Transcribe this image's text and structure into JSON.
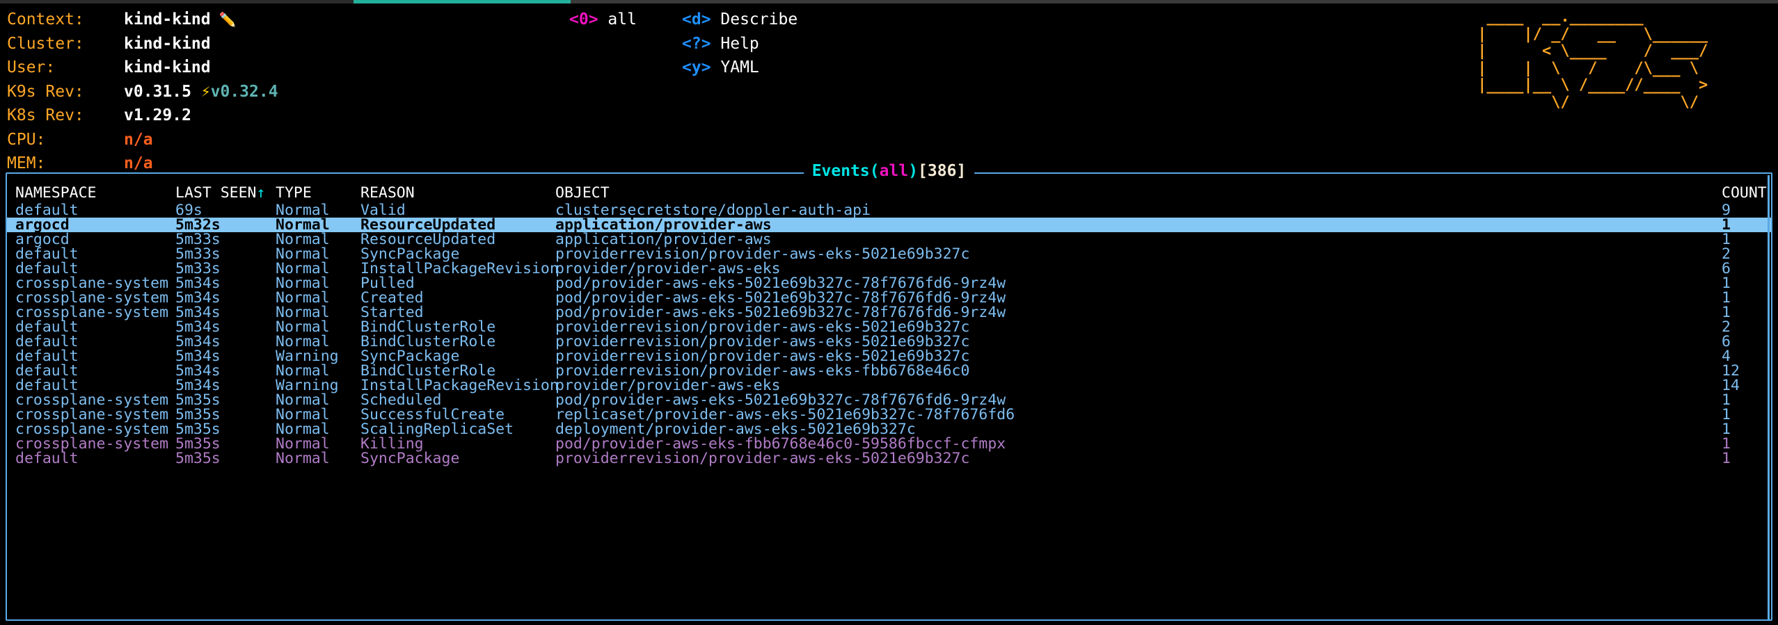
{
  "app": {
    "name": "k9s",
    "logo_art": [
      " ____  __.________              ",
      "|    |/ _/   __   \\______      ",
      "|      < \\____    /  ___/      ",
      "|    |  \\   /    /\\___ \\     ",
      "|____|__ \\ /____//____  >      ",
      "        \\/            \\/       "
    ]
  },
  "colors": {
    "accent_orange": "#ffa726",
    "accent_cyan": "#00e5e5",
    "accent_magenta": "#f012be",
    "accent_blue": "#1e90ff",
    "row_text": "#7dbdf0",
    "row_killing": "#b07cc6",
    "selected_bg": "#85c8f5",
    "border_blue": "#5aa9e6",
    "na_orange": "#ff5f1f",
    "new_version_teal": "#5fb3b3",
    "strip_teal": "#23b09b"
  },
  "cluster_info": {
    "rows": [
      {
        "key": "Context:",
        "value": "kind-kind",
        "icon": "pencil-icon",
        "icon_glyph": "✏️"
      },
      {
        "key": "Cluster:",
        "value": "kind-kind"
      },
      {
        "key": "User:",
        "value": "kind-kind"
      },
      {
        "key": "K9s Rev:",
        "value": "v0.31.5",
        "new_version": "v0.32.4",
        "bolt_glyph": "⚡"
      },
      {
        "key": "K8s Rev:",
        "value": "v1.29.2"
      },
      {
        "key": "CPU:",
        "value": "n/a",
        "na": true
      },
      {
        "key": "MEM:",
        "value": "n/a",
        "na": true
      }
    ]
  },
  "hints": {
    "left": [
      {
        "key": "<0>",
        "label": "all",
        "key_color": "magenta"
      }
    ],
    "right": [
      {
        "key": "<d>",
        "label": "Describe",
        "key_color": "blue"
      },
      {
        "key": "<?>",
        "label": "Help",
        "key_color": "blue"
      },
      {
        "key": "<y>",
        "label": "YAML",
        "key_color": "blue"
      }
    ]
  },
  "panel": {
    "title_main": "Events",
    "title_open_paren": "(",
    "title_scope": "all",
    "title_close_paren": ")",
    "title_count": "[386]"
  },
  "table": {
    "columns": [
      {
        "key": "namespace",
        "label": "NAMESPACE"
      },
      {
        "key": "last_seen",
        "label": "LAST SEEN",
        "sorted": true,
        "sort_glyph": "↑"
      },
      {
        "key": "type",
        "label": "TYPE"
      },
      {
        "key": "reason",
        "label": "REASON"
      },
      {
        "key": "object",
        "label": "OBJECT"
      },
      {
        "key": "count",
        "label": "COUNT"
      }
    ],
    "rows": [
      {
        "namespace": "default",
        "last_seen": "69s",
        "type": "Normal",
        "reason": "Valid",
        "object": "clustersecretstore/doppler-auth-api",
        "count": "9",
        "state": "normal"
      },
      {
        "namespace": "argocd",
        "last_seen": "5m32s",
        "type": "Normal",
        "reason": "ResourceUpdated",
        "object": "application/provider-aws",
        "count": "1",
        "state": "selected"
      },
      {
        "namespace": "argocd",
        "last_seen": "5m33s",
        "type": "Normal",
        "reason": "ResourceUpdated",
        "object": "application/provider-aws",
        "count": "1",
        "state": "normal"
      },
      {
        "namespace": "default",
        "last_seen": "5m33s",
        "type": "Normal",
        "reason": "SyncPackage",
        "object": "providerrevision/provider-aws-eks-5021e69b327c",
        "count": "2",
        "state": "normal"
      },
      {
        "namespace": "default",
        "last_seen": "5m33s",
        "type": "Normal",
        "reason": "InstallPackageRevision",
        "object": "provider/provider-aws-eks",
        "count": "6",
        "state": "normal"
      },
      {
        "namespace": "crossplane-system",
        "last_seen": "5m34s",
        "type": "Normal",
        "reason": "Pulled",
        "object": "pod/provider-aws-eks-5021e69b327c-78f7676fd6-9rz4w",
        "count": "1",
        "state": "normal"
      },
      {
        "namespace": "crossplane-system",
        "last_seen": "5m34s",
        "type": "Normal",
        "reason": "Created",
        "object": "pod/provider-aws-eks-5021e69b327c-78f7676fd6-9rz4w",
        "count": "1",
        "state": "normal"
      },
      {
        "namespace": "crossplane-system",
        "last_seen": "5m34s",
        "type": "Normal",
        "reason": "Started",
        "object": "pod/provider-aws-eks-5021e69b327c-78f7676fd6-9rz4w",
        "count": "1",
        "state": "normal"
      },
      {
        "namespace": "default",
        "last_seen": "5m34s",
        "type": "Normal",
        "reason": "BindClusterRole",
        "object": "providerrevision/provider-aws-eks-5021e69b327c",
        "count": "2",
        "state": "normal"
      },
      {
        "namespace": "default",
        "last_seen": "5m34s",
        "type": "Normal",
        "reason": "BindClusterRole",
        "object": "providerrevision/provider-aws-eks-5021e69b327c",
        "count": "6",
        "state": "normal"
      },
      {
        "namespace": "default",
        "last_seen": "5m34s",
        "type": "Warning",
        "reason": "SyncPackage",
        "object": "providerrevision/provider-aws-eks-5021e69b327c",
        "count": "4",
        "state": "normal"
      },
      {
        "namespace": "default",
        "last_seen": "5m34s",
        "type": "Normal",
        "reason": "BindClusterRole",
        "object": "providerrevision/provider-aws-eks-fbb6768e46c0",
        "count": "12",
        "state": "normal"
      },
      {
        "namespace": "default",
        "last_seen": "5m34s",
        "type": "Warning",
        "reason": "InstallPackageRevision",
        "object": "provider/provider-aws-eks",
        "count": "14",
        "state": "normal"
      },
      {
        "namespace": "crossplane-system",
        "last_seen": "5m35s",
        "type": "Normal",
        "reason": "Scheduled",
        "object": "pod/provider-aws-eks-5021e69b327c-78f7676fd6-9rz4w",
        "count": "1",
        "state": "normal"
      },
      {
        "namespace": "crossplane-system",
        "last_seen": "5m35s",
        "type": "Normal",
        "reason": "SuccessfulCreate",
        "object": "replicaset/provider-aws-eks-5021e69b327c-78f7676fd6",
        "count": "1",
        "state": "normal"
      },
      {
        "namespace": "crossplane-system",
        "last_seen": "5m35s",
        "type": "Normal",
        "reason": "ScalingReplicaSet",
        "object": "deployment/provider-aws-eks-5021e69b327c",
        "count": "1",
        "state": "normal"
      },
      {
        "namespace": "crossplane-system",
        "last_seen": "5m35s",
        "type": "Normal",
        "reason": "Killing",
        "object": "pod/provider-aws-eks-fbb6768e46c0-59586fbccf-cfmpx",
        "count": "1",
        "state": "killing"
      },
      {
        "namespace": "default",
        "last_seen": "5m35s",
        "type": "Normal",
        "reason": "SyncPackage",
        "object": "providerrevision/provider-aws-eks-5021e69b327c",
        "count": "1",
        "state": "killing"
      }
    ]
  }
}
